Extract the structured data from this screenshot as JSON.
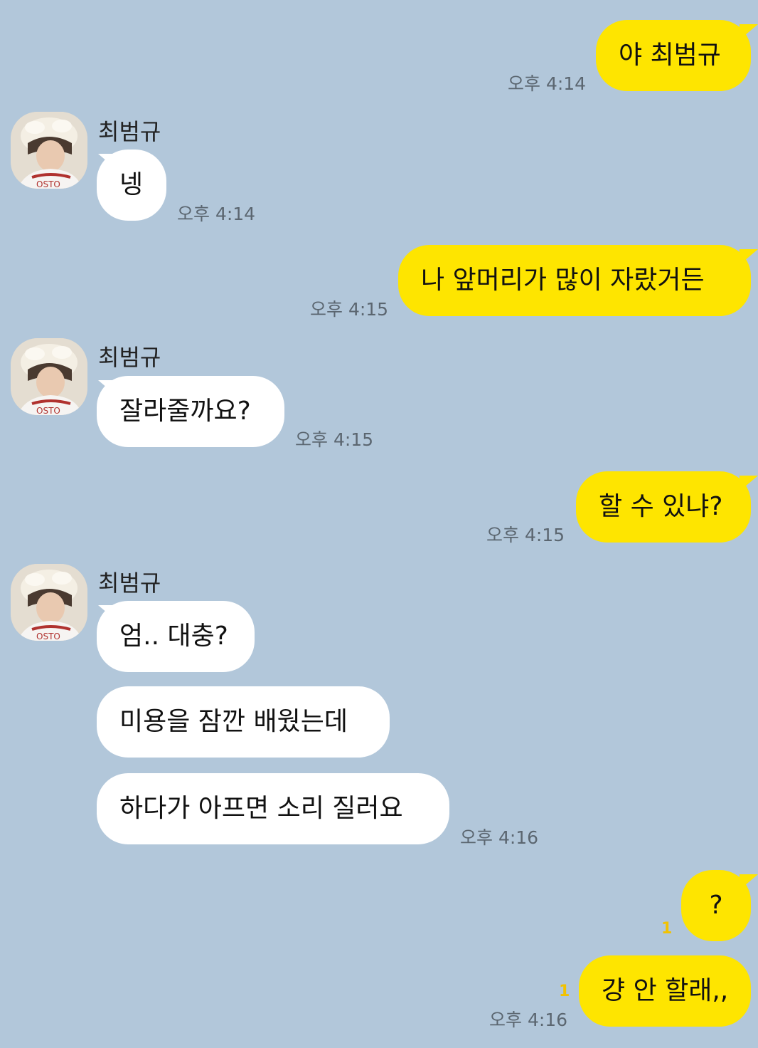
{
  "contact": {
    "name": "최범규"
  },
  "messages": [
    {
      "id": "m1",
      "text": "야 최범규",
      "time": "오후 4:14"
    },
    {
      "id": "m2",
      "text": "넹",
      "time": "오후 4:14"
    },
    {
      "id": "m3",
      "text": "나 앞머리가 많이 자랐거든",
      "time": "오후 4:15"
    },
    {
      "id": "m4",
      "text": "잘라줄까요?",
      "time": "오후 4:15"
    },
    {
      "id": "m5",
      "text": "할 수 있냐?",
      "time": "오후 4:15"
    },
    {
      "id": "m6",
      "text": "엄.. 대충?",
      "time": ""
    },
    {
      "id": "m7",
      "text": "미용을 잠깐 배웠는데",
      "time": ""
    },
    {
      "id": "m8",
      "text": "하다가 아프면 소리 질러요",
      "time": "오후 4:16"
    },
    {
      "id": "m9",
      "text": "?",
      "unread": "1",
      "time": ""
    },
    {
      "id": "m10",
      "text": "걍 안 할래,,",
      "unread": "1",
      "time": "오후 4:16"
    }
  ],
  "colors": {
    "background": "#b2c7da",
    "my_bubble": "#fee500",
    "their_bubble": "#ffffff",
    "unread": "#f2c200"
  }
}
